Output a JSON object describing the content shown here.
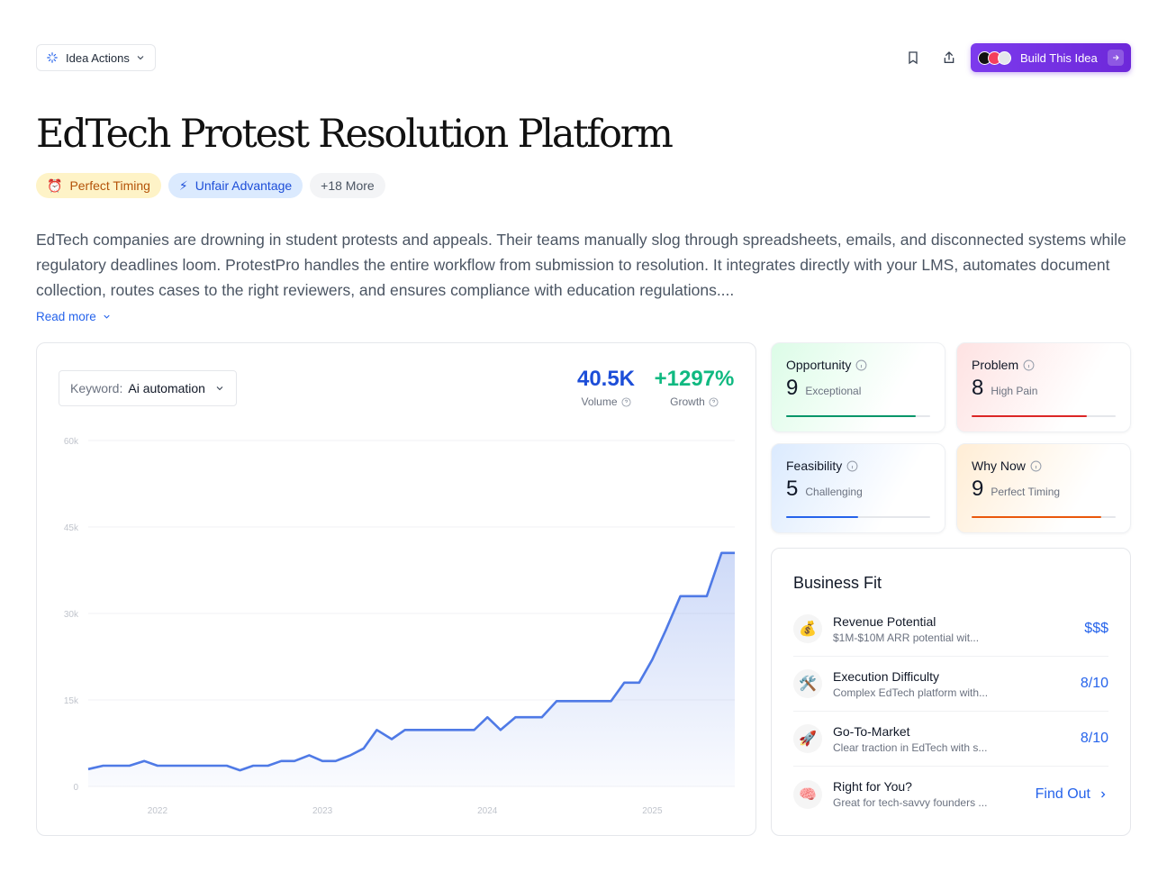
{
  "toolbar": {
    "idea_actions_label": "Idea Actions",
    "build_label": "Build This Idea"
  },
  "page": {
    "title": "EdTech Protest Resolution Platform",
    "tags": [
      {
        "emoji": "⏰",
        "label": "Perfect Timing"
      },
      {
        "emoji": "⚡",
        "label": "Unfair Advantage"
      },
      {
        "label": "+18 More"
      }
    ],
    "description": "EdTech companies are drowning in student protests and appeals. Their teams manually slog through spreadsheets, emails, and disconnected systems while regulatory deadlines loom. ProtestPro handles the entire workflow from submission to resolution. It integrates directly with your LMS, automates document collection, routes cases to the right reviewers, and ensures compliance with education regulations....",
    "read_more": "Read more"
  },
  "keyword": {
    "label": "Keyword:",
    "value": "Ai automation"
  },
  "metrics": {
    "volume": {
      "value": "40.5K",
      "label": "Volume",
      "color": "#1d4ed8"
    },
    "growth": {
      "value": "+1297%",
      "label": "Growth",
      "color": "#10b981"
    }
  },
  "chart_data": {
    "type": "area",
    "y_ticks": [
      "60k",
      "45k",
      "30k",
      "15k",
      "0"
    ],
    "x_ticks": [
      "2022",
      "2023",
      "2024",
      "2025"
    ],
    "ylim": [
      0,
      60000
    ],
    "x_tick_positions": [
      2022,
      2023,
      2024,
      2025
    ],
    "xlim": [
      2021.58,
      2025.5
    ],
    "series": [
      {
        "color": "#4f7ae6",
        "points": [
          [
            2021.58,
            3000
          ],
          [
            2021.67,
            3600
          ],
          [
            2021.75,
            3600
          ],
          [
            2021.83,
            3600
          ],
          [
            2021.92,
            4400
          ],
          [
            2022.0,
            3600
          ],
          [
            2022.08,
            3600
          ],
          [
            2022.17,
            3600
          ],
          [
            2022.25,
            3600
          ],
          [
            2022.33,
            3600
          ],
          [
            2022.42,
            3600
          ],
          [
            2022.5,
            2800
          ],
          [
            2022.58,
            3600
          ],
          [
            2022.67,
            3600
          ],
          [
            2022.75,
            4400
          ],
          [
            2022.83,
            4400
          ],
          [
            2022.92,
            5400
          ],
          [
            2023.0,
            4400
          ],
          [
            2023.08,
            4400
          ],
          [
            2023.17,
            5400
          ],
          [
            2023.25,
            6600
          ],
          [
            2023.33,
            9800
          ],
          [
            2023.42,
            8200
          ],
          [
            2023.5,
            9800
          ],
          [
            2023.58,
            9800
          ],
          [
            2023.67,
            9800
          ],
          [
            2023.75,
            9800
          ],
          [
            2023.83,
            9800
          ],
          [
            2023.92,
            9800
          ],
          [
            2024.0,
            12000
          ],
          [
            2024.08,
            9800
          ],
          [
            2024.17,
            12000
          ],
          [
            2024.25,
            12000
          ],
          [
            2024.33,
            12000
          ],
          [
            2024.42,
            14800
          ],
          [
            2024.5,
            14800
          ],
          [
            2024.58,
            14800
          ],
          [
            2024.67,
            14800
          ],
          [
            2024.75,
            14800
          ],
          [
            2024.83,
            18000
          ],
          [
            2024.92,
            18000
          ],
          [
            2025.0,
            22000
          ],
          [
            2025.08,
            27000
          ],
          [
            2025.17,
            33000
          ],
          [
            2025.25,
            33000
          ],
          [
            2025.33,
            33000
          ],
          [
            2025.42,
            40500
          ],
          [
            2025.5,
            40500
          ]
        ]
      }
    ]
  },
  "scores": [
    {
      "label": "Opportunity",
      "value": "9",
      "sub": "Exceptional",
      "fraction": 0.9,
      "color": "#059669"
    },
    {
      "label": "Problem",
      "value": "8",
      "sub": "High Pain",
      "fraction": 0.8,
      "color": "#dc2626"
    },
    {
      "label": "Feasibility",
      "value": "5",
      "sub": "Challenging",
      "fraction": 0.5,
      "color": "#2563eb"
    },
    {
      "label": "Why Now",
      "value": "9",
      "sub": "Perfect Timing",
      "fraction": 0.9,
      "color": "#ea580c"
    }
  ],
  "business_fit": {
    "title": "Business Fit",
    "rows": [
      {
        "icon": "💰",
        "name": "Revenue Potential",
        "sub": "$1M-$10M ARR potential wit...",
        "value": "$$$"
      },
      {
        "icon": "🛠️",
        "name": "Execution Difficulty",
        "sub": "Complex EdTech platform with...",
        "value": "8/10"
      },
      {
        "icon": "🚀",
        "name": "Go-To-Market",
        "sub": "Clear traction in EdTech with s...",
        "value": "8/10"
      },
      {
        "icon": "🧠",
        "name": "Right for You?",
        "sub": "Great for tech-savvy founders ...",
        "value": "Find Out"
      }
    ]
  }
}
